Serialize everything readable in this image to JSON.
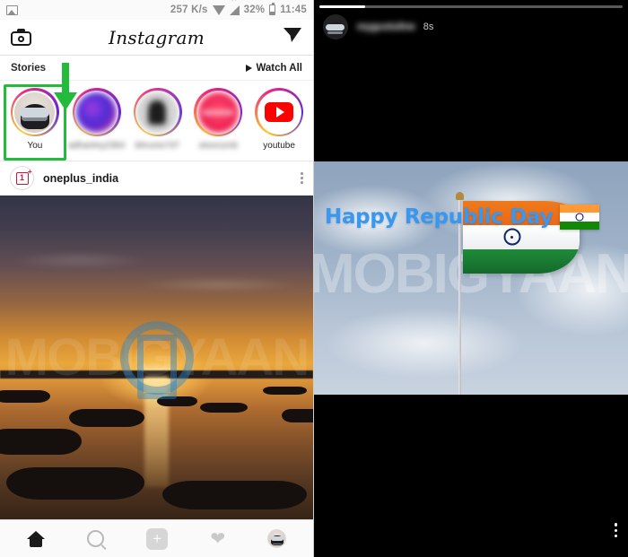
{
  "left_panel": {
    "status_bar": {
      "network_speed": "257 K/s",
      "battery_percent": "32%",
      "time": "11:45",
      "icons": [
        "gallery-icon",
        "wifi-icon",
        "signal-icon",
        "battery-icon"
      ]
    },
    "app_header": {
      "title": "Instagram",
      "camera_icon": "camera-icon",
      "direct_icon": "send-paper-plane-icon"
    },
    "stories_bar": {
      "label": "Stories",
      "watch_all": "Watch All",
      "play_icon": "play-triangle-icon",
      "annotation_arrow": "green-down-arrow"
    },
    "stories": [
      {
        "name": "You",
        "highlighted": true,
        "avatar": "user-vr-headset-avatar"
      },
      {
        "name": "adhantny2364",
        "highlighted": false,
        "avatar": "blurred-purple-avatar"
      },
      {
        "name": "bhrunix747",
        "highlighted": false,
        "avatar": "blurred-dark-avatar"
      },
      {
        "name": "stoorzznb",
        "highlighted": false,
        "avatar": "blurred-red-avatar"
      },
      {
        "name": "youtube",
        "highlighted": false,
        "avatar": "youtube-logo-avatar"
      }
    ],
    "post": {
      "username": "oneplus_india",
      "avatar": "oneplus-logo-avatar",
      "options_icon": "three-dots-vertical-icon",
      "image_alt": "sunset-over-river-with-boats",
      "watermark": "MOBIGYAAN"
    },
    "bottom_nav": [
      {
        "name": "home",
        "icon": "home-icon",
        "active": true
      },
      {
        "name": "search",
        "icon": "search-icon",
        "active": false
      },
      {
        "name": "add-post",
        "icon": "plus-icon",
        "active": false
      },
      {
        "name": "activity",
        "icon": "heart-icon",
        "active": false
      },
      {
        "name": "profile",
        "icon": "profile-avatar-icon",
        "active": false
      }
    ]
  },
  "right_panel": {
    "progress_percent": 15,
    "header": {
      "username": "mygustuline",
      "timestamp": "8s",
      "avatar": "user-vr-headset-avatar"
    },
    "story_media": {
      "greeting_text": "Happy Republic Day",
      "flag_emoji": "india-flag-emoji",
      "image_alt": "indian-flag-on-pole-against-cloudy-sky",
      "watermark": "MOBIGYAAN"
    },
    "options_icon": "three-dots-vertical-icon"
  },
  "colors": {
    "accent_blue": "#3897f0",
    "highlight_green": "#22bb3b",
    "flag_saffron": "#FF9933",
    "flag_green": "#138808",
    "youtube_red": "#ff0000",
    "oneplus_red": "#c4193c"
  }
}
